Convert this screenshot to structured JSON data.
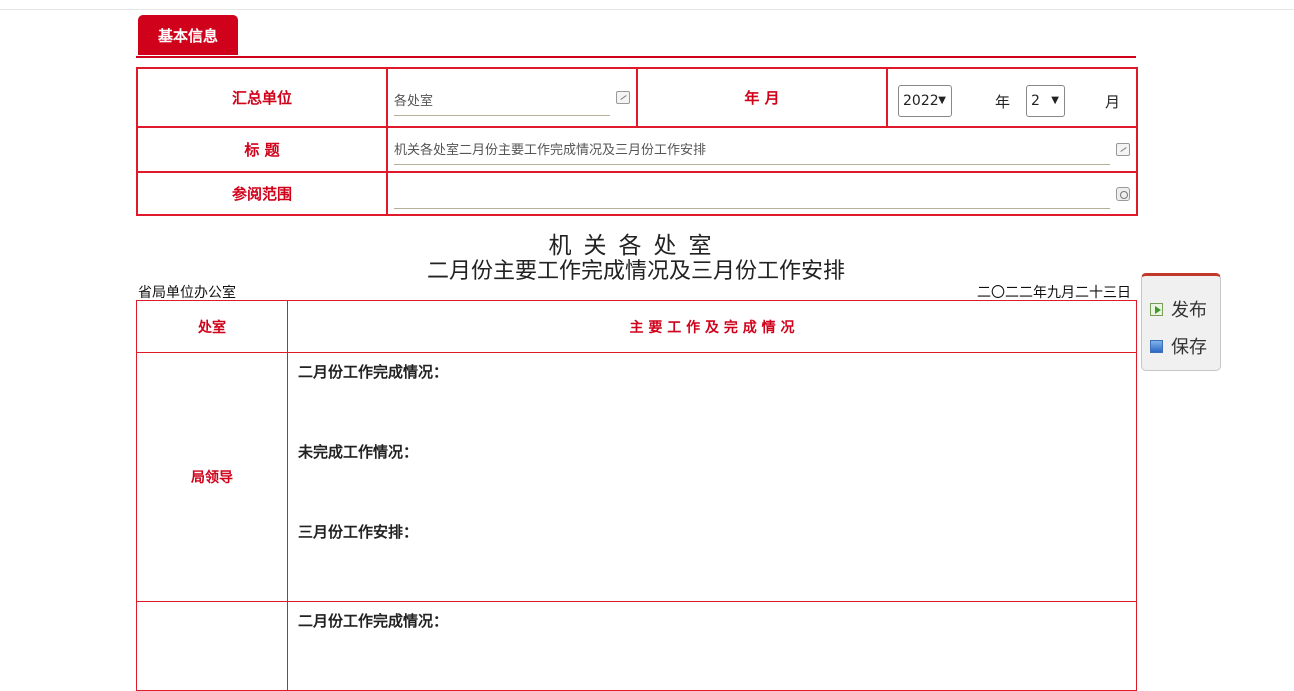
{
  "tab": {
    "label": "基本信息"
  },
  "form": {
    "unit_label": "汇总单位",
    "unit_value": "各处室",
    "ym_label": "年 月",
    "year_value": "2022",
    "year_suffix": "年",
    "month_value": "2",
    "month_suffix": "月",
    "title_label": "标 题",
    "title_value": "机关各处室二月份主要工作完成情况及三月份工作安排",
    "scope_label": "参阅范围",
    "scope_value": ""
  },
  "document": {
    "title_line1": "机关各处室",
    "title_line2": "二月份主要工作完成情况及三月份工作安排",
    "office": "省局单位办公室",
    "date": "二〇二二年九月二十三日"
  },
  "table": {
    "header_dept": "处室",
    "header_work": "主 要 工 作 及 完 成 情 况",
    "rows": [
      {
        "dept": "局领导",
        "items": [
          "二月份工作完成情况：",
          "未完成工作情况：",
          "三月份工作安排："
        ]
      },
      {
        "dept": "",
        "items": [
          "二月份工作完成情况："
        ]
      }
    ]
  },
  "actions": {
    "publish_label": "发布",
    "save_label": "保存"
  },
  "colors": {
    "accent": "#d0021b"
  }
}
